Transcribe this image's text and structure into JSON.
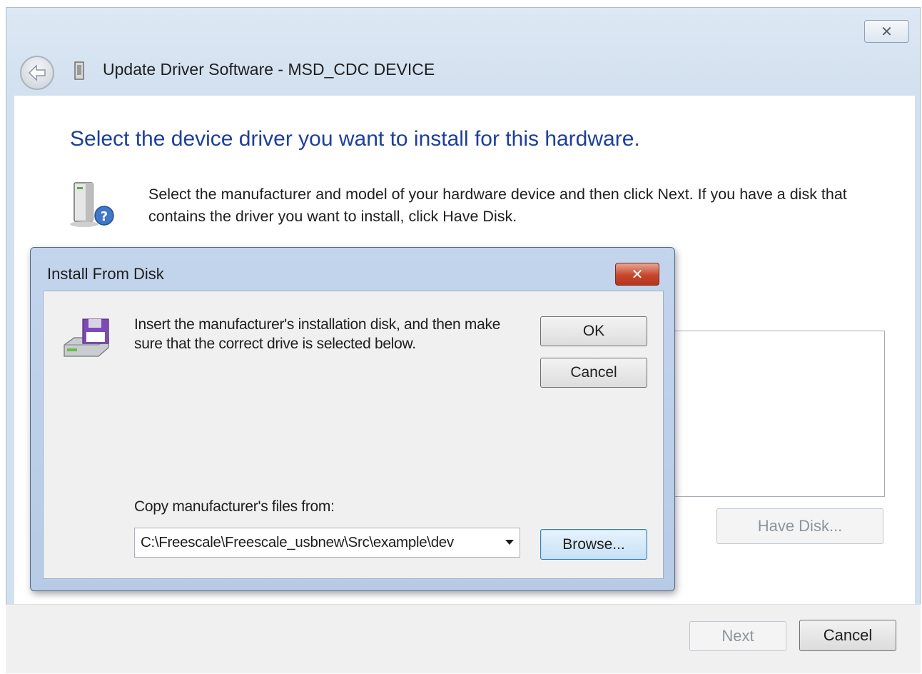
{
  "wizard": {
    "close_glyph": "✕",
    "title": "Update Driver Software - MSD_CDC DEVICE",
    "heading": "Select the device driver you want to install for this hardware.",
    "intro": "Select the manufacturer and model of your hardware device and then click Next. If you have a disk that contains the driver you want to install, click Have Disk.",
    "have_disk_label": "Have Disk...",
    "next_label": "Next",
    "cancel_label": "Cancel",
    "icons": {
      "back": "back-arrow-icon",
      "usb": "usb-device-icon",
      "hardware": "hardware-help-icon"
    }
  },
  "dialog": {
    "title": "Install From Disk",
    "close_glyph": "✕",
    "message": "Insert the manufacturer's installation disk, and then make sure that the correct drive is selected below.",
    "ok_label": "OK",
    "cancel_label": "Cancel",
    "copy_label": "Copy manufacturer's files from:",
    "path_value": "C:\\Freescale\\Freescale_usbnew\\Src\\example\\dev",
    "browse_label": "Browse...",
    "icons": {
      "disk": "floppy-disk-drive-icon"
    }
  },
  "colors": {
    "heading_blue": "#1e3f9a",
    "dialog_close_red": "#c6462c",
    "frame_blue": "#c3d5ec"
  }
}
